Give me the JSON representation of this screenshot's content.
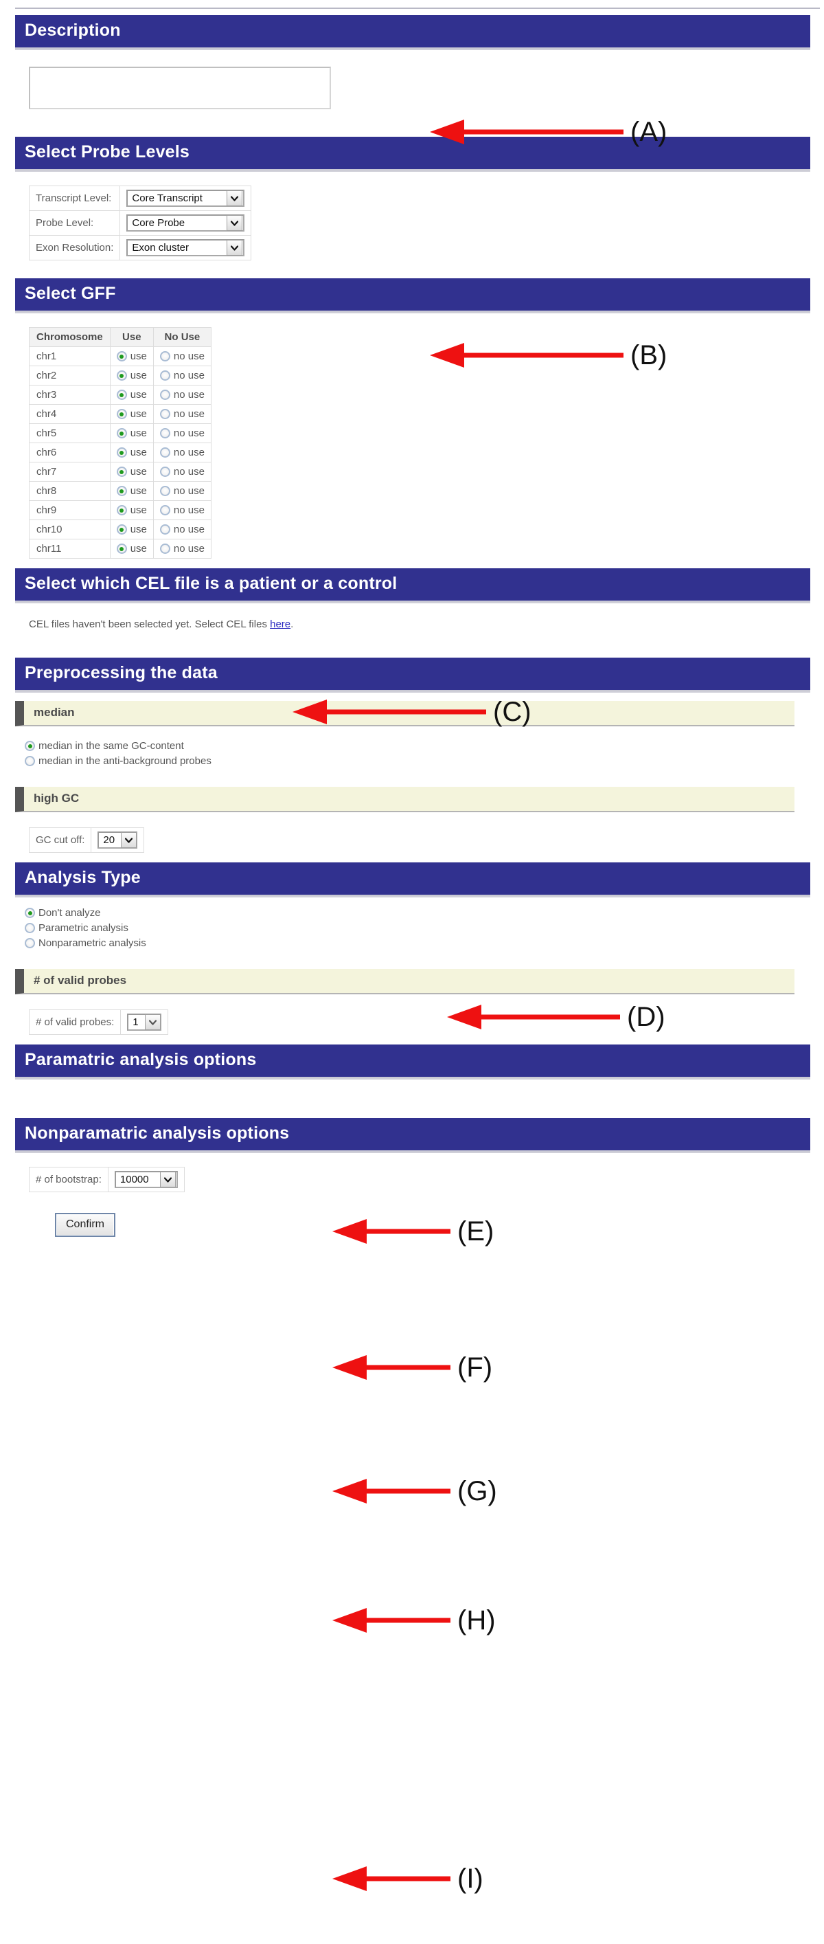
{
  "colors": {
    "header_blue": "#31318f",
    "subheader_cream": "#f4f4dc",
    "subheader_bar": "#555555",
    "arrow_red": "#ee1111",
    "link_blue": "#2b2bc0",
    "radio_dot_green": "#1f9a1f"
  },
  "sections": {
    "description": {
      "title": "Description",
      "input_value": "",
      "input_placeholder": ""
    },
    "probe_levels": {
      "title": "Select Probe Levels",
      "rows": [
        {
          "label": "Transcript Level:",
          "value": "Core Transcript"
        },
        {
          "label": "Probe Level:",
          "value": "Core Probe"
        },
        {
          "label": "Exon Resolution:",
          "value": "Exon cluster"
        }
      ]
    },
    "gff": {
      "title": "Select GFF",
      "columns": [
        "Chromosome",
        "Use",
        "No Use"
      ],
      "use_label": "use",
      "no_use_label": "no use",
      "rows": [
        {
          "chromosome": "chr1",
          "selected": "use"
        },
        {
          "chromosome": "chr2",
          "selected": "use"
        },
        {
          "chromosome": "chr3",
          "selected": "use"
        },
        {
          "chromosome": "chr4",
          "selected": "use"
        },
        {
          "chromosome": "chr5",
          "selected": "use"
        },
        {
          "chromosome": "chr6",
          "selected": "use"
        },
        {
          "chromosome": "chr7",
          "selected": "use"
        },
        {
          "chromosome": "chr8",
          "selected": "use"
        },
        {
          "chromosome": "chr9",
          "selected": "use"
        },
        {
          "chromosome": "chr10",
          "selected": "use"
        },
        {
          "chromosome": "chr11",
          "selected": "use"
        }
      ]
    },
    "cel": {
      "title": "Select which CEL file is a patient or a control",
      "note_before": "CEL files haven't been selected yet. Select CEL files ",
      "note_link": "here",
      "note_after": "."
    },
    "preprocessing": {
      "title": "Preprocessing the data",
      "median": {
        "subtitle": "median",
        "options": [
          {
            "label": "median in the same GC-content",
            "checked": true
          },
          {
            "label": "median in the anti-background probes",
            "checked": false
          }
        ]
      },
      "high_gc": {
        "subtitle": "high GC",
        "field_label": "GC cut off:",
        "field_value": "20"
      }
    },
    "analysis_type": {
      "title": "Analysis Type",
      "options": [
        {
          "label": "Don't analyze",
          "checked": true
        },
        {
          "label": "Parametric analysis",
          "checked": false
        },
        {
          "label": "Nonparametric analysis",
          "checked": false
        }
      ],
      "valid_probes": {
        "subtitle": "# of valid probes",
        "field_label": "# of valid probes:",
        "field_value": "1"
      }
    },
    "parametric_options": {
      "title": "Paramatric analysis options"
    },
    "nonparametric_options": {
      "title": "Nonparamatric analysis options",
      "field_label": "# of bootstrap:",
      "field_value": "10000",
      "confirm_label": "Confirm"
    }
  },
  "annotations": [
    {
      "id": "A",
      "label": "(A)"
    },
    {
      "id": "B",
      "label": "(B)"
    },
    {
      "id": "C",
      "label": "(C)"
    },
    {
      "id": "D",
      "label": "(D)"
    },
    {
      "id": "E",
      "label": "(E)"
    },
    {
      "id": "F",
      "label": "(F)"
    },
    {
      "id": "G",
      "label": "(G)"
    },
    {
      "id": "H",
      "label": "(H)"
    },
    {
      "id": "I",
      "label": "(I)"
    }
  ]
}
